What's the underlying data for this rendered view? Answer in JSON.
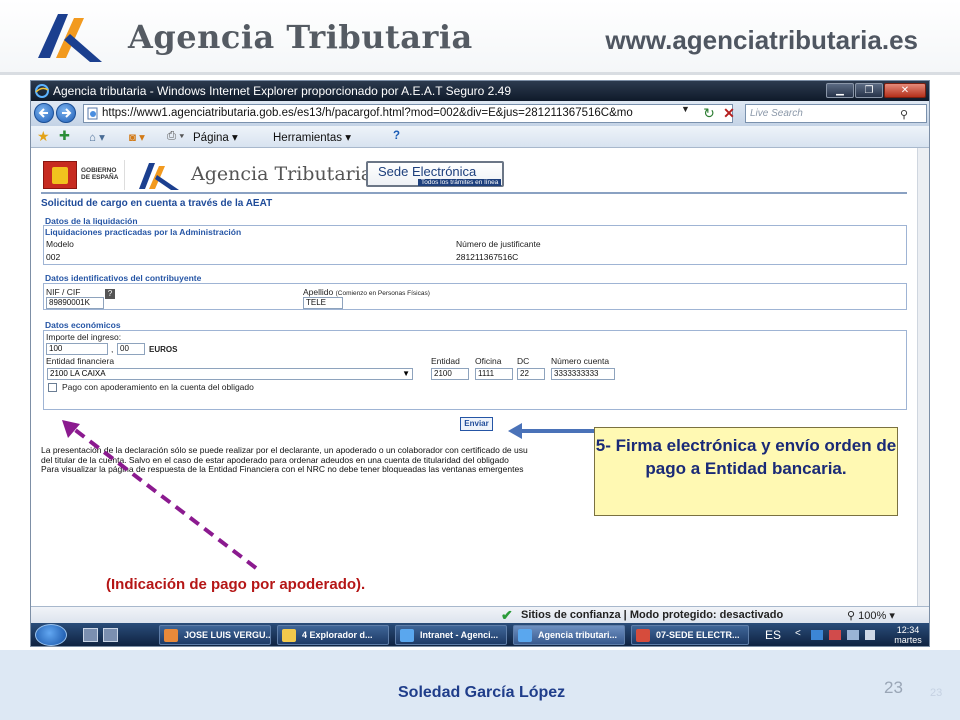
{
  "header": {
    "logo_text": "Agencia Tributaria",
    "url_text": "www.agenciatributaria.es"
  },
  "browser": {
    "window_title": "Agencia tributaria - Windows Internet Explorer proporcionado por A.E.A.T Seguro 2.49",
    "address": "https://www1.agenciatributaria.gob.es/es13/h/pacargof.html?mod=002&div=E&jus=281211367516C&mo",
    "search_placeholder": "Live Search",
    "commands": {
      "page": "Página ▾",
      "tools": "Herramientas ▾",
      "help": "?"
    },
    "status": "Sitios de confianza | Modo protegido: desactivado",
    "zoom": "100%"
  },
  "page": {
    "gov_text": "GOBIERNO DE ESPAÑA",
    "banner_title": "Agencia Tributaria",
    "sede_title": "Sede Electrónica",
    "sede_sub": "Todos los trámites en línea",
    "heading": "Solicitud de cargo en cuenta a través de la AEAT",
    "liquidacion": {
      "title": "Datos de la liquidación",
      "subtitle": "Liquidaciones practicadas por la Administración",
      "modelo_label": "Modelo",
      "modelo_value": "002",
      "justificante_label": "Número de justificante",
      "justificante_value": "281211367516C"
    },
    "contribuyente": {
      "title": "Datos identificativos del contribuyente",
      "nif_label": "NIF / CIF",
      "nif_value": "89890001K",
      "apellido_label": "Apellido",
      "apellido_hint": "(Comienzo en Personas Físicas)",
      "apellido_value": "TELE"
    },
    "economicos": {
      "title": "Datos económicos",
      "importe_label": "Importe del ingreso:",
      "importe_entero": "100",
      "importe_decimal": "00",
      "sep": ",",
      "moneda": "EUROS",
      "entidad_label": "Entidad financiera",
      "entidad_value": "2100 LA CAIXA",
      "col_entidad": "Entidad",
      "col_oficina": "Oficina",
      "col_dc": "DC",
      "col_cuenta": "Número cuenta",
      "entidad_code": "2100",
      "oficina_code": "1111",
      "dc_code": "22",
      "cuenta_code": "3333333333",
      "checkbox_label": "Pago con apoderamiento en la cuenta del obligado"
    },
    "enviar": "Enviar",
    "legal_1": "La presentación de la declaración sólo se puede realizar por el declarante, un apoderado o un colaborador con certificado de usu",
    "legal_2": "del titular de la cuenta. Salvo en el caso de estar apoderado para ordenar adeudos en una cuenta de titularidad del obligado",
    "legal_3": "Para visualizar la página de respuesta de la Entidad Financiera con el NRC no debe tener bloqueadas las ventanas emergentes"
  },
  "callout": "5- Firma electrónica y envío orden de pago a Entidad bancaria.",
  "annotation": "(Indicación de pago por apoderado).",
  "taskbar": {
    "tasks": [
      "JOSE LUIS VERGU...",
      "4 Explorador d...",
      "Intranet - Agenci...",
      "Agencia tributari...",
      "07-SEDE ELECTR..."
    ],
    "lang": "ES",
    "time": "12:34",
    "day": "martes"
  },
  "footer": {
    "author": "Soledad García López",
    "slide_number": "23",
    "slide_number_ghost": "23"
  },
  "colors": {
    "callout_bg": "#fff9b3",
    "callout_text": "#1a2a77",
    "annotation": "#b51616",
    "dashed_arrow": "#8b1a8f",
    "blue_arrow": "#4a72b8"
  }
}
